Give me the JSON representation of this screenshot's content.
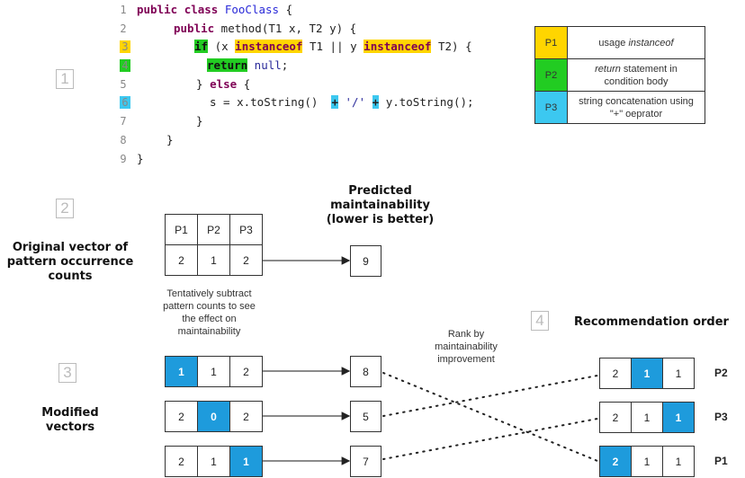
{
  "colors": {
    "p1": "#ffd500",
    "p2": "#22cc22",
    "p3": "#3cc8f0",
    "highlight": "#1e9bdc"
  },
  "steps": [
    "1",
    "2",
    "3",
    "4"
  ],
  "code": {
    "line_numbers": [
      "1",
      "2",
      "3",
      "4",
      "5",
      "6",
      "7",
      "8",
      "9"
    ],
    "l1": {
      "kw1": "public",
      "kw2": "class",
      "cls": "FooClass",
      "rest": " {"
    },
    "l2": {
      "kw": "public",
      "rest": " method(T1 x, T2 y) {"
    },
    "l3": {
      "kw": "if",
      "a": " (x ",
      "inst1": "instanceof",
      "b": " T1 || y ",
      "inst2": "instanceof",
      "c": " T2) {"
    },
    "l4": {
      "kw": "return",
      "nul": " null",
      "rest": ";"
    },
    "l5": {
      "a": "} ",
      "kw": "else",
      "b": " {"
    },
    "l6": {
      "a": "s = x.toString()  ",
      "plus1": "+",
      "b": " '/' ",
      "plus2": "+",
      "c": " y.toString();"
    },
    "l7": "}",
    "l8": "}",
    "l9": "}"
  },
  "legend": [
    {
      "id": "P1",
      "desc_pre": "usage ",
      "desc_em": "instanceof",
      "desc_post": ""
    },
    {
      "id": "P2",
      "desc_pre": "",
      "desc_em": "return",
      "desc_post": " statement in condition body"
    },
    {
      "id": "P3",
      "desc_pre": "string concatenation using \"+\" oeprator",
      "desc_em": "",
      "desc_post": ""
    }
  ],
  "original": {
    "label": "Original vector of pattern occurrence counts",
    "headers": [
      "P1",
      "P2",
      "P3"
    ],
    "values": [
      "2",
      "1",
      "2"
    ],
    "predicted": "9",
    "predicted_label": "Predicted maintainability (lower is better)",
    "note": "Tentatively subtract pattern counts to see the effect on maintainability"
  },
  "modified": {
    "label": "Modified vectors",
    "rows": [
      {
        "values": [
          "1",
          "1",
          "2"
        ],
        "highlight": 0,
        "predicted": "8"
      },
      {
        "values": [
          "2",
          "0",
          "2"
        ],
        "highlight": 1,
        "predicted": "5"
      },
      {
        "values": [
          "2",
          "1",
          "1"
        ],
        "highlight": 2,
        "predicted": "7"
      }
    ]
  },
  "rank_label": "Rank by maintainability improvement",
  "recommendation": {
    "title": "Recommendation order",
    "rows": [
      {
        "values": [
          "2",
          "1",
          "1"
        ],
        "highlight": 1,
        "pattern": "P2"
      },
      {
        "values": [
          "2",
          "1",
          "1"
        ],
        "highlight": 2,
        "pattern": "P3"
      },
      {
        "values": [
          "2",
          "1",
          "1"
        ],
        "highlight": 0,
        "pattern": "P1"
      }
    ]
  }
}
